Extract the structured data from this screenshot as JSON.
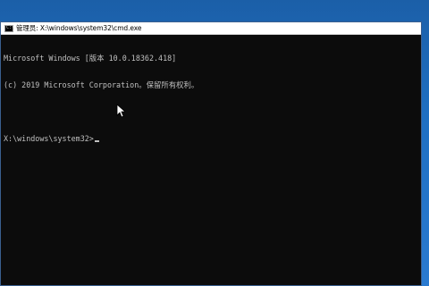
{
  "window": {
    "title": "管理员: X:\\windows\\system32\\cmd.exe",
    "icon": "cmd-icon",
    "icon_text": "C:\\"
  },
  "console": {
    "line1": "Microsoft Windows [版本 10.0.18362.418]",
    "line2": "(c) 2019 Microsoft Corporation。保留所有权利。",
    "line3": "",
    "prompt": "X:\\windows\\system32>"
  },
  "colors": {
    "console_bg": "#0c0c0c",
    "console_fg": "#c0c0c0",
    "desktop_bg": "#1f6fc2",
    "titlebar_bg": "#ffffff"
  },
  "pointer": {
    "icon": "mouse-pointer-icon"
  }
}
